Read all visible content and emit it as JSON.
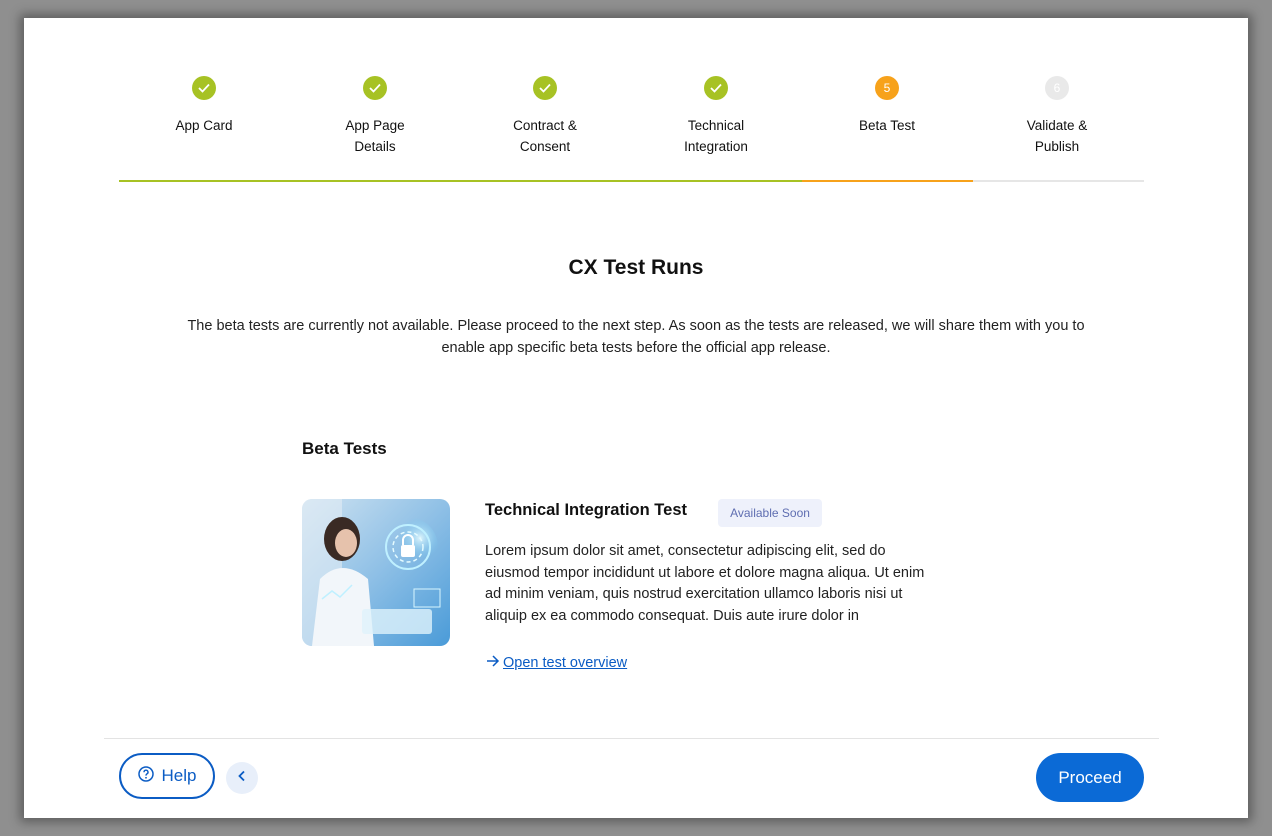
{
  "stepper": {
    "steps": [
      {
        "label": "App Card",
        "status": "done",
        "number": ""
      },
      {
        "label": "App Page\nDetails",
        "status": "done",
        "number": ""
      },
      {
        "label": "Contract &\nConsent",
        "status": "done",
        "number": ""
      },
      {
        "label": "Technical\nIntegration",
        "status": "done",
        "number": ""
      },
      {
        "label": "Beta Test",
        "status": "active",
        "number": "5"
      },
      {
        "label": "Validate &\nPublish",
        "status": "todo",
        "number": "6"
      }
    ],
    "colors": {
      "done": "#a7c224",
      "active": "#f7a21b",
      "todo": "#e9e9e9"
    }
  },
  "main": {
    "title": "CX Test Runs",
    "intro": "The beta tests are currently not available. Please proceed to the next step. As soon as the tests are released, we will share them with you to enable app specific beta tests before the official app release."
  },
  "beta_tests": {
    "section_title": "Beta Tests",
    "card": {
      "title": "Technical Integration Test",
      "badge": "Available Soon",
      "description": "Lorem ipsum dolor sit amet, consectetur adipiscing elit, sed do eiusmod tempor incididunt ut labore et dolore magna aliqua. Ut enim ad minim veniam, quis nostrud exercitation ullamco laboris nisi ut aliquip ex ea commodo consequat. Duis aute irure dolor in",
      "link_label": "Open test overview"
    }
  },
  "footer": {
    "help_label": "Help",
    "proceed_label": "Proceed"
  },
  "colors": {
    "primary": "#0b6ad6",
    "badge_bg": "#eef1fb",
    "badge_text": "#5f6eb1"
  }
}
